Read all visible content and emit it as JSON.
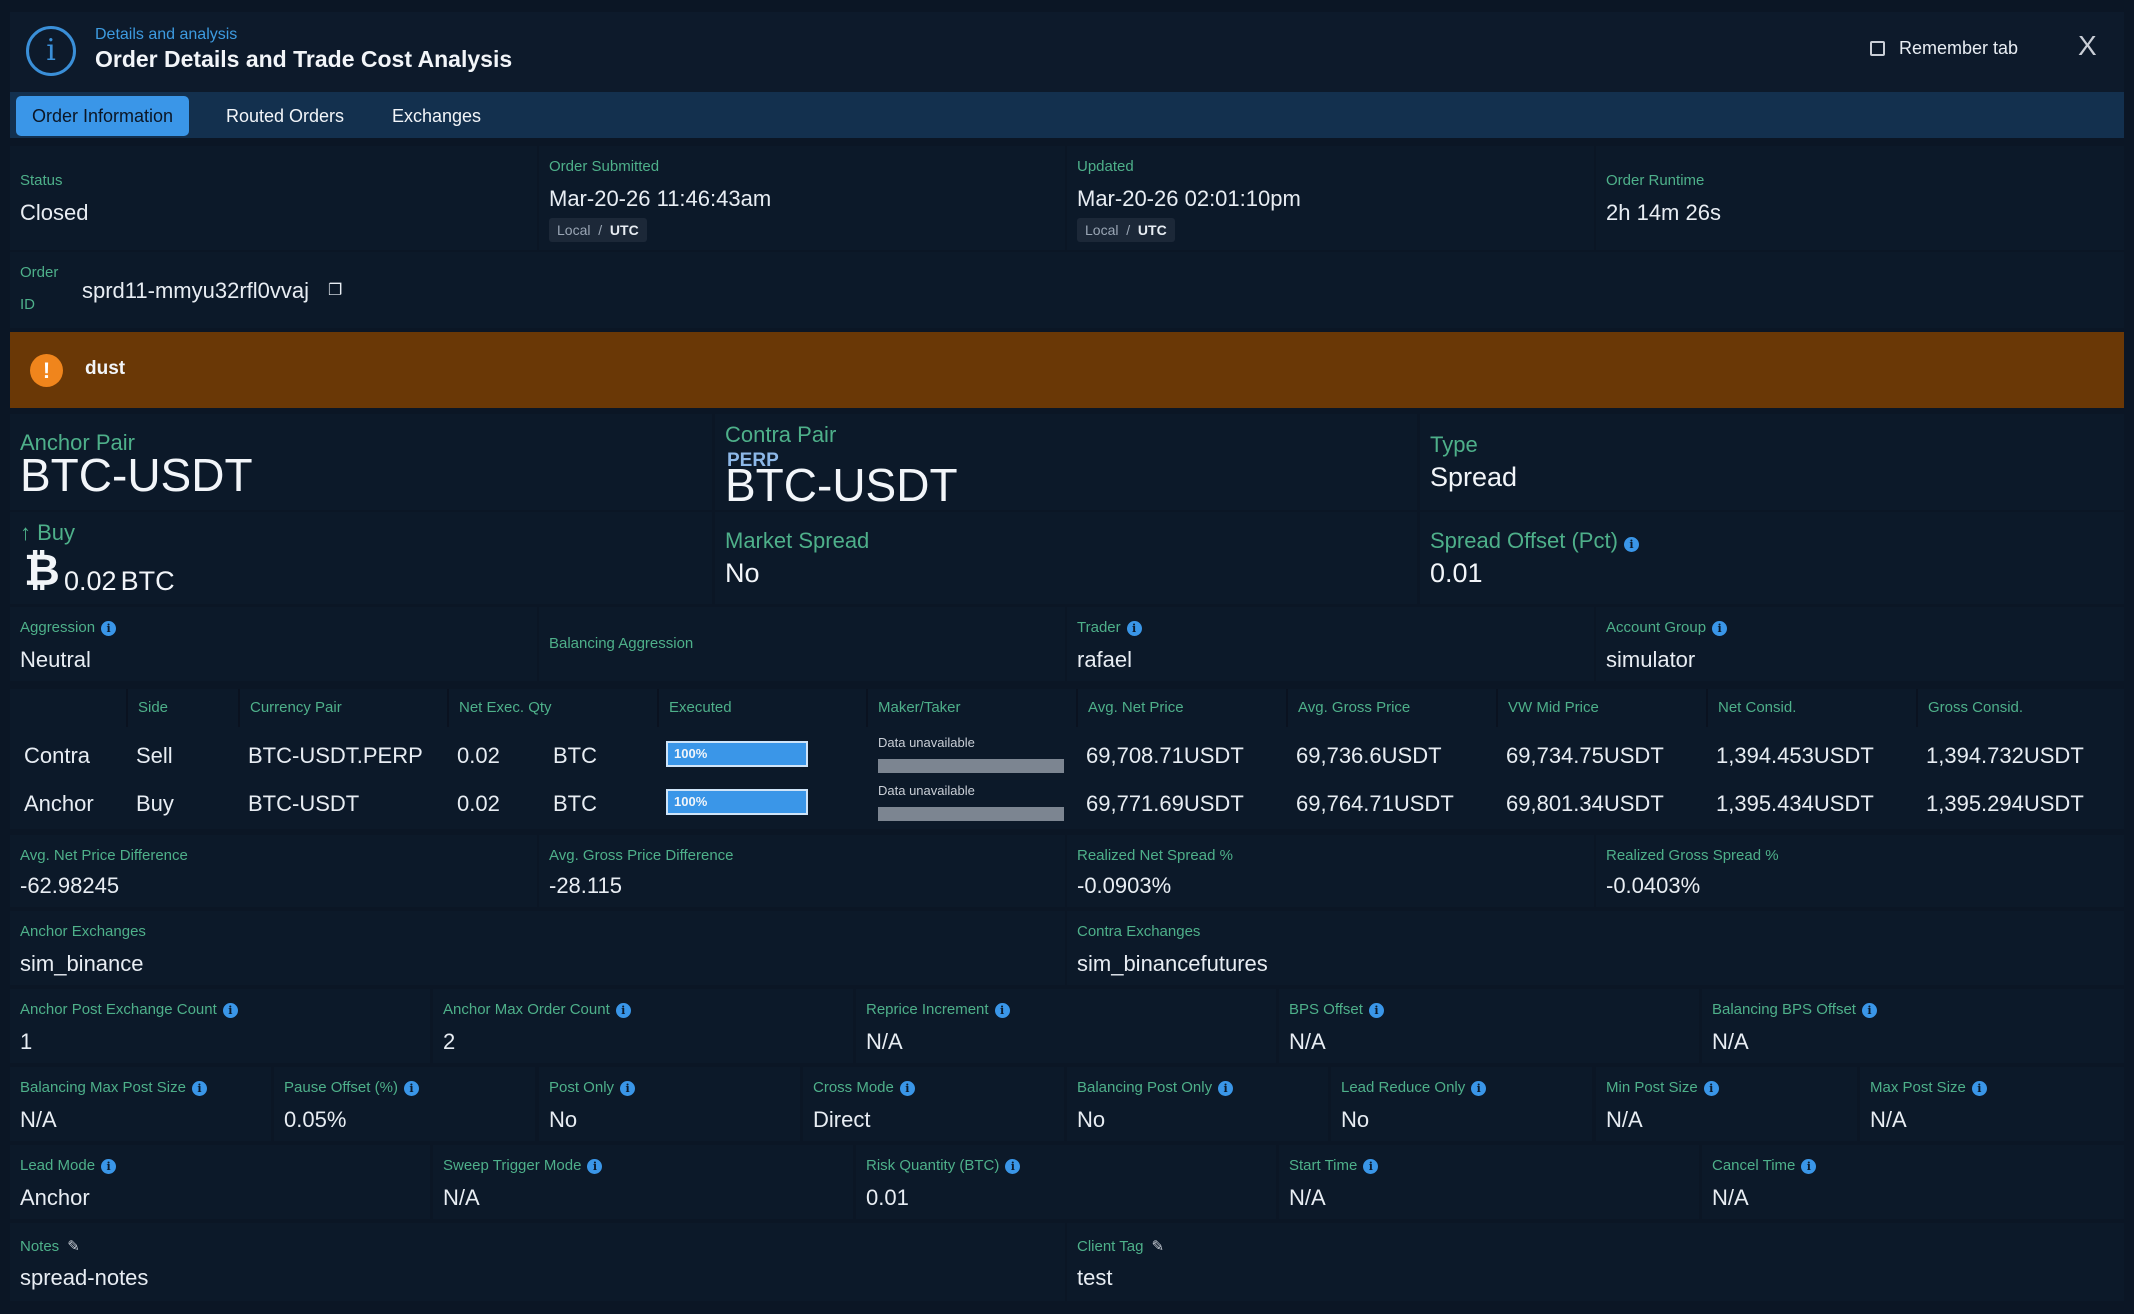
{
  "header": {
    "subtitle": "Details and analysis",
    "title": "Order Details and Trade Cost Analysis",
    "remember_tab": "Remember tab",
    "close": "X"
  },
  "tabs": [
    {
      "label": "Order Information",
      "active": true
    },
    {
      "label": "Routed Orders",
      "active": false
    },
    {
      "label": "Exchanges",
      "active": false
    }
  ],
  "status": {
    "status_label": "Status",
    "status_value": "Closed",
    "submitted_label": "Order Submitted",
    "submitted_value": "Mar-20-26 11:46:43am",
    "updated_label": "Updated",
    "updated_value": "Mar-20-26 02:01:10pm",
    "runtime_label": "Order Runtime",
    "runtime_value": "2h 14m 26s",
    "tz_local": "Local",
    "tz_sep": "/",
    "tz_utc": "UTC"
  },
  "order_id": {
    "label_line1": "Order",
    "label_line2": "ID",
    "value": "sprd11-mmyu32rfl0vvaj"
  },
  "banner": {
    "text": "dust",
    "color": "#6a3806"
  },
  "pairs": {
    "anchor_label": "Anchor Pair",
    "anchor_value": "BTC-USDT",
    "contra_label": "Contra Pair",
    "contra_badge": "PERP",
    "contra_value": "BTC-USDT",
    "type_label": "Type",
    "type_value": "Spread",
    "side_label": "Buy",
    "qty_value": "0.02",
    "qty_unit": "BTC",
    "market_spread_label": "Market Spread",
    "market_spread_value": "No",
    "spread_offset_label": "Spread Offset (Pct)",
    "spread_offset_value": "0.01"
  },
  "row1": {
    "aggression_label": "Aggression",
    "aggression_value": "Neutral",
    "balancing_aggression_label": "Balancing Aggression",
    "trader_label": "Trader",
    "trader_value": "rafael",
    "account_group_label": "Account Group",
    "account_group_value": "simulator"
  },
  "table": {
    "headers": [
      "Side",
      "Currency Pair",
      "Net Exec. Qty",
      "Executed",
      "Maker/Taker",
      "Avg. Net Price",
      "Avg. Gross Price",
      "VW Mid Price",
      "Net Consid.",
      "Gross Consid."
    ],
    "rows": [
      {
        "leg": "Contra",
        "side": "Sell",
        "pair": "BTC-USDT.PERP",
        "qty": "0.02",
        "unit": "BTC",
        "executed": "100%",
        "executed_pct": 100,
        "maker_taker": "Data unavailable",
        "avg_net": "69,708.71USDT",
        "avg_gross": "69,736.6USDT",
        "vw_mid": "69,734.75USDT",
        "net_consid": "1,394.453USDT",
        "gross_consid": "1,394.732USDT"
      },
      {
        "leg": "Anchor",
        "side": "Buy",
        "pair": "BTC-USDT",
        "qty": "0.02",
        "unit": "BTC",
        "executed": "100%",
        "executed_pct": 100,
        "maker_taker": "Data unavailable",
        "avg_net": "69,771.69USDT",
        "avg_gross": "69,764.71USDT",
        "vw_mid": "69,801.34USDT",
        "net_consid": "1,395.434USDT",
        "gross_consid": "1,395.294USDT"
      }
    ]
  },
  "diffs": {
    "net_diff_label": "Avg. Net Price Difference",
    "net_diff_value": "-62.98245",
    "gross_diff_label": "Avg. Gross Price Difference",
    "gross_diff_value": "-28.115",
    "net_spread_label": "Realized Net Spread %",
    "net_spread_value": "-0.0903%",
    "gross_spread_label": "Realized Gross Spread %",
    "gross_spread_value": "-0.0403%"
  },
  "exchanges": {
    "anchor_label": "Anchor Exchanges",
    "anchor_value": "sim_binance",
    "contra_label": "Contra Exchanges",
    "contra_value": "sim_binancefutures"
  },
  "params1": [
    {
      "label": "Anchor Post Exchange Count",
      "value": "1"
    },
    {
      "label": "Anchor Max Order Count",
      "value": "2"
    },
    {
      "label": "Reprice Increment",
      "value": "N/A"
    },
    {
      "label": "BPS Offset",
      "value": "N/A"
    },
    {
      "label": "Balancing BPS Offset",
      "value": "N/A"
    }
  ],
  "params2": [
    {
      "label": "Balancing Max Post Size",
      "value": "N/A"
    },
    {
      "label": "Pause Offset (%)",
      "value": "0.05%"
    },
    {
      "label": "Post Only",
      "value": "No"
    },
    {
      "label": "Cross Mode",
      "value": "Direct"
    },
    {
      "label": "Balancing Post Only",
      "value": "No"
    },
    {
      "label": "Lead Reduce Only",
      "value": "No"
    },
    {
      "label": "Min Post Size",
      "value": "N/A"
    },
    {
      "label": "Max Post Size",
      "value": "N/A"
    }
  ],
  "params3": [
    {
      "label": "Lead Mode",
      "value": "Anchor"
    },
    {
      "label": "Sweep Trigger Mode",
      "value": "N/A"
    },
    {
      "label": "Risk Quantity (BTC)",
      "value": "0.01"
    },
    {
      "label": "Start Time",
      "value": "N/A"
    },
    {
      "label": "Cancel Time",
      "value": "N/A"
    }
  ],
  "notes": {
    "notes_label": "Notes",
    "notes_value": "spread-notes",
    "client_tag_label": "Client Tag",
    "client_tag_value": "test"
  }
}
